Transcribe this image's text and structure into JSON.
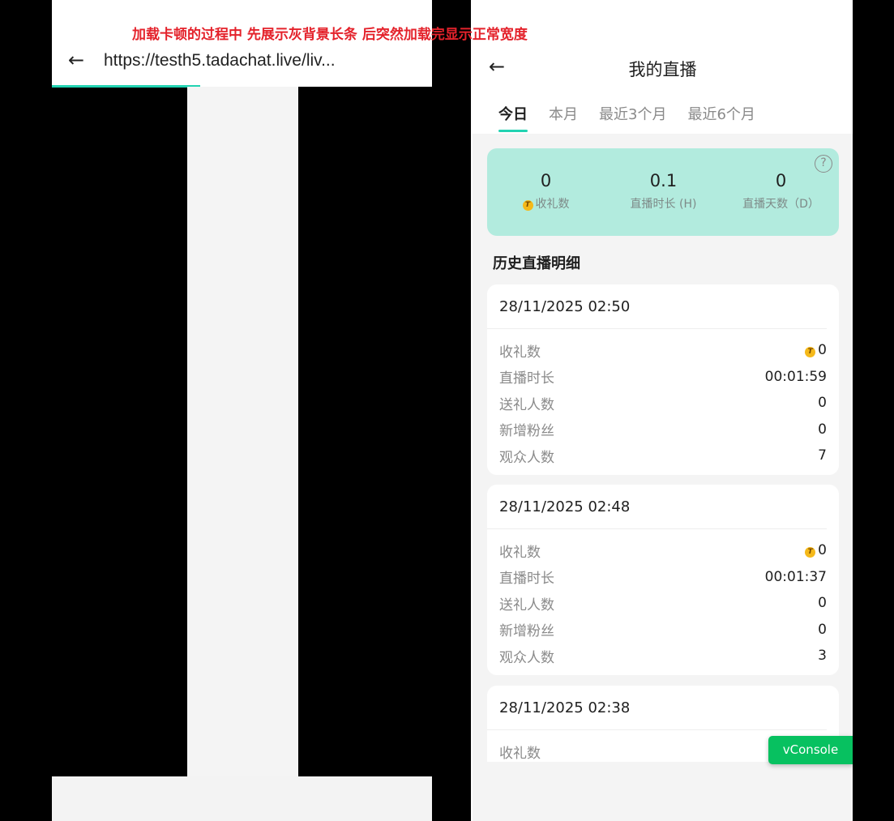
{
  "annotation": "加载卡顿的过程中 先展示灰背景长条 后突然加载完显示正常宽度",
  "left": {
    "back_glyph": "←",
    "url": "https://testh5.tadachat.live/liv..."
  },
  "right": {
    "back_glyph": "←",
    "title": "我的直播",
    "tabs": [
      {
        "label": "今日",
        "active": true
      },
      {
        "label": "本月",
        "active": false
      },
      {
        "label": "最近3个月",
        "active": false
      },
      {
        "label": "最近6个月",
        "active": false
      }
    ],
    "summary": {
      "help": "?",
      "stats": [
        {
          "value": "0",
          "label": "收礼数",
          "coin": true
        },
        {
          "value": "0.1",
          "label": "直播时长 (H)",
          "coin": false
        },
        {
          "value": "0",
          "label": "直播天数（D）",
          "coin": false
        }
      ]
    },
    "section_title": "历史直播明细",
    "records": [
      {
        "date": "28/11/2025 02:50",
        "rows": [
          {
            "k": "收礼数",
            "v": "0",
            "coin": true
          },
          {
            "k": "直播时长",
            "v": "00:01:59"
          },
          {
            "k": "送礼人数",
            "v": "0"
          },
          {
            "k": "新增粉丝",
            "v": "0"
          },
          {
            "k": "观众人数",
            "v": "7"
          }
        ]
      },
      {
        "date": "28/11/2025 02:48",
        "rows": [
          {
            "k": "收礼数",
            "v": "0",
            "coin": true
          },
          {
            "k": "直播时长",
            "v": "00:01:37"
          },
          {
            "k": "送礼人数",
            "v": "0"
          },
          {
            "k": "新增粉丝",
            "v": "0"
          },
          {
            "k": "观众人数",
            "v": "3"
          }
        ]
      },
      {
        "date": "28/11/2025 02:38",
        "rows": [
          {
            "k": "收礼数",
            "v": ""
          }
        ]
      }
    ],
    "vconsole": "vConsole",
    "coin_letter": "T"
  },
  "colors": {
    "accent": "#22d3b2",
    "summary_bg": "#b2ebde",
    "annotation": "#e4222b",
    "vconsole": "#07c160"
  }
}
